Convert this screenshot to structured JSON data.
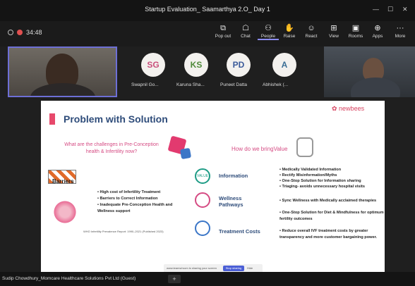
{
  "window": {
    "title": "Startup Evaluation_ Saamarthya 2.O_ Day 1",
    "minimize": "—",
    "maximize": "☐",
    "close": "✕"
  },
  "meeting": {
    "timer": "34:48"
  },
  "toolbar": {
    "items": [
      {
        "label": "Pop out",
        "icon": "pop-out-icon",
        "glyph": "⧉"
      },
      {
        "label": "Chat",
        "icon": "chat-icon",
        "glyph": "☖"
      },
      {
        "label": "People",
        "icon": "people-icon",
        "glyph": "⚇"
      },
      {
        "label": "Raise",
        "icon": "raise-hand-icon",
        "glyph": "✋"
      },
      {
        "label": "React",
        "icon": "react-icon",
        "glyph": "☺"
      },
      {
        "label": "View",
        "icon": "view-icon",
        "glyph": "⊞"
      },
      {
        "label": "Rooms",
        "icon": "rooms-icon",
        "glyph": "▣"
      },
      {
        "label": "Apps",
        "icon": "apps-icon",
        "glyph": "⊕"
      },
      {
        "label": "More",
        "icon": "more-icon",
        "glyph": "···"
      }
    ]
  },
  "participants": [
    {
      "initials": "SG",
      "name": "Swapnil Go...",
      "color": "#c94f7c"
    },
    {
      "initials": "KS",
      "name": "Karuna Sha...",
      "color": "#4f8a3a"
    },
    {
      "initials": "PD",
      "name": "Puneet Datta",
      "color": "#3b5a9a"
    },
    {
      "initials": "A",
      "name": "Abhishek (...",
      "color": "#3b6e95"
    }
  ],
  "slide": {
    "title": "Problem with Solution",
    "logo": "newbees",
    "question": "What are the challenges in Pre-Conception health & Infertility now?",
    "how": "How do we bringValue",
    "barriers_label": "Barriers",
    "barriers": [
      "High cost of Infertility Treatment",
      "Barriers to Correct Information",
      "Inadequate Pre-Conception Health and Wellness support"
    ],
    "source": "WHO Infertility Prevalence Report: 1990–2021 (Published 2023)",
    "pillars": [
      {
        "label": "Information",
        "points": [
          "Medically Validated Information",
          "Rectify Misinformation/Myths",
          "One-Stop Solution for Information sharing",
          "Triaging- avoids unnecessary hospital visits"
        ]
      },
      {
        "label": "Wellness Pathways",
        "points": [
          "Sync Wellness with Medically acclaimed therapies",
          "One-Stop Solution for Diet & Mindfulness for optimum fertility outcomes"
        ]
      },
      {
        "label": "Treatment Costs",
        "points": [
          "Reduce overall IVF treatment costs by greater transparency and more customer bargaining power."
        ]
      }
    ]
  },
  "sharing": {
    "text": "www.teams/room is sharing your screen",
    "stop": "Stop sharing",
    "hide": "Hide"
  },
  "bottom": {
    "presenter": "Sudip Chowdhury_Momcare Healthcare Solutions Pvt Ltd (Guest)",
    "add": "+"
  }
}
